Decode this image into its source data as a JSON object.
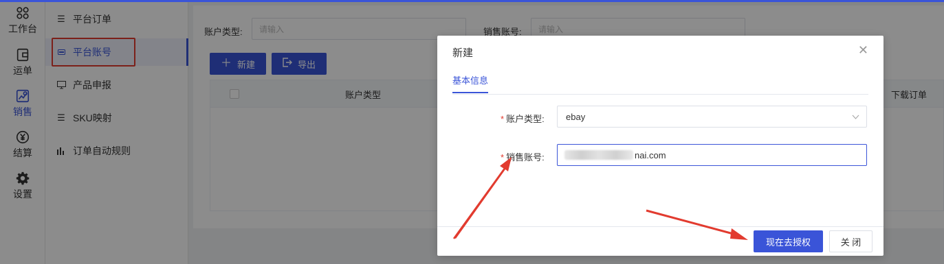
{
  "rail": {
    "items": [
      {
        "label": "工作台",
        "icon": "workbench-icon"
      },
      {
        "label": "运单",
        "icon": "waybill-icon"
      },
      {
        "label": "销售",
        "icon": "sales-icon"
      },
      {
        "label": "结算",
        "icon": "yuan-icon"
      },
      {
        "label": "设置",
        "icon": "gear-icon"
      }
    ],
    "active_label": "销售"
  },
  "subnav": {
    "items": [
      {
        "label": "平台订单",
        "icon": "list-icon"
      },
      {
        "label": "平台账号",
        "icon": "card-icon"
      },
      {
        "label": "产品申报",
        "icon": "monitor-icon"
      },
      {
        "label": "SKU映射",
        "icon": "list-icon"
      },
      {
        "label": "订单自动规则",
        "icon": "bar-chart-icon"
      }
    ],
    "active_label": "平台账号"
  },
  "filters": {
    "account_type_label": "账户类型:",
    "account_type_placeholder": "请输入",
    "sales_account_label": "销售账号:",
    "sales_account_placeholder": "请输入"
  },
  "toolbar": {
    "new_label": "新建",
    "export_label": "导出"
  },
  "table": {
    "columns": [
      "账户类型",
      "下载订单"
    ]
  },
  "modal": {
    "title": "新建",
    "tab": "基本信息",
    "account_type_label": "账户类型:",
    "account_type_value": "ebay",
    "sales_account_label": "销售账号:",
    "sales_account_value_visible": "nai.com",
    "authorize_label": "现在去授权",
    "close_label": "关 闭"
  },
  "colors": {
    "accent": "#3a54d8",
    "highlight_red": "#e23b2f",
    "required_star": "#e23b2f"
  }
}
